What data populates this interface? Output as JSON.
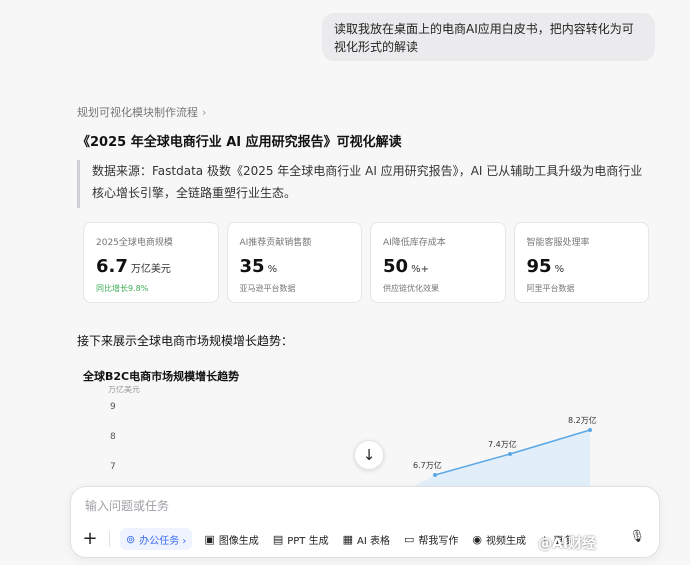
{
  "user_message": "读取我放在桌面上的电商AI应用白皮书，把内容转化为可视化形式的解读",
  "flow_link": "规划可视化模块制作流程",
  "report_title": "《2025 年全球电商行业 AI 应用研究报告》可视化解读",
  "quote": "数据来源：Fastdata 极数《2025 年全球电商行业 AI 应用研究报告》，AI 已从辅助工具升级为电商行业核心增长引擎，全链路重塑行业生态。",
  "cards": [
    {
      "label": "2025全球电商规模",
      "value": "6.7",
      "unit": "万亿美元",
      "sub": "同比增长9.8%",
      "sub_color": "#3fae59"
    },
    {
      "label": "AI推荐贡献销售额",
      "value": "35",
      "unit": "%",
      "sub": "亚马逊平台数据"
    },
    {
      "label": "AI降低库存成本",
      "value": "50",
      "unit": "%+",
      "sub": "供应链优化效果"
    },
    {
      "label": "智能客服处理率",
      "value": "95",
      "unit": "%",
      "sub": "阿里平台数据"
    }
  ],
  "section_head": "接下来展示全球电商市场规模增长趋势：",
  "chart_data": {
    "type": "area",
    "title": "全球B2C电商市场规模增长趋势",
    "ylabel": "万亿美元",
    "y_ticks": [
      9,
      8,
      7
    ],
    "ylim": [
      6.5,
      9
    ],
    "x": [
      0,
      1,
      2
    ],
    "values": [
      6.7,
      7.4,
      8.2
    ],
    "data_labels": [
      "6.7万亿",
      "7.4万亿",
      "8.2万亿"
    ],
    "fill_color": "#dcebf9",
    "line_color": "#5aa7e6"
  },
  "composer": {
    "placeholder": "输入问题或任务",
    "tools": [
      {
        "icon": "task-icon",
        "label": "办公任务 ›",
        "active": true
      },
      {
        "icon": "image-icon",
        "label": "图像生成"
      },
      {
        "icon": "ppt-icon",
        "label": "PPT 生成"
      },
      {
        "icon": "table-icon",
        "label": "AI 表格"
      },
      {
        "icon": "write-icon",
        "label": "帮我写作"
      },
      {
        "icon": "video-icon",
        "label": "视频生成"
      },
      {
        "icon": "more-icon",
        "label": "更多"
      }
    ]
  },
  "watermark": "@AI财经"
}
